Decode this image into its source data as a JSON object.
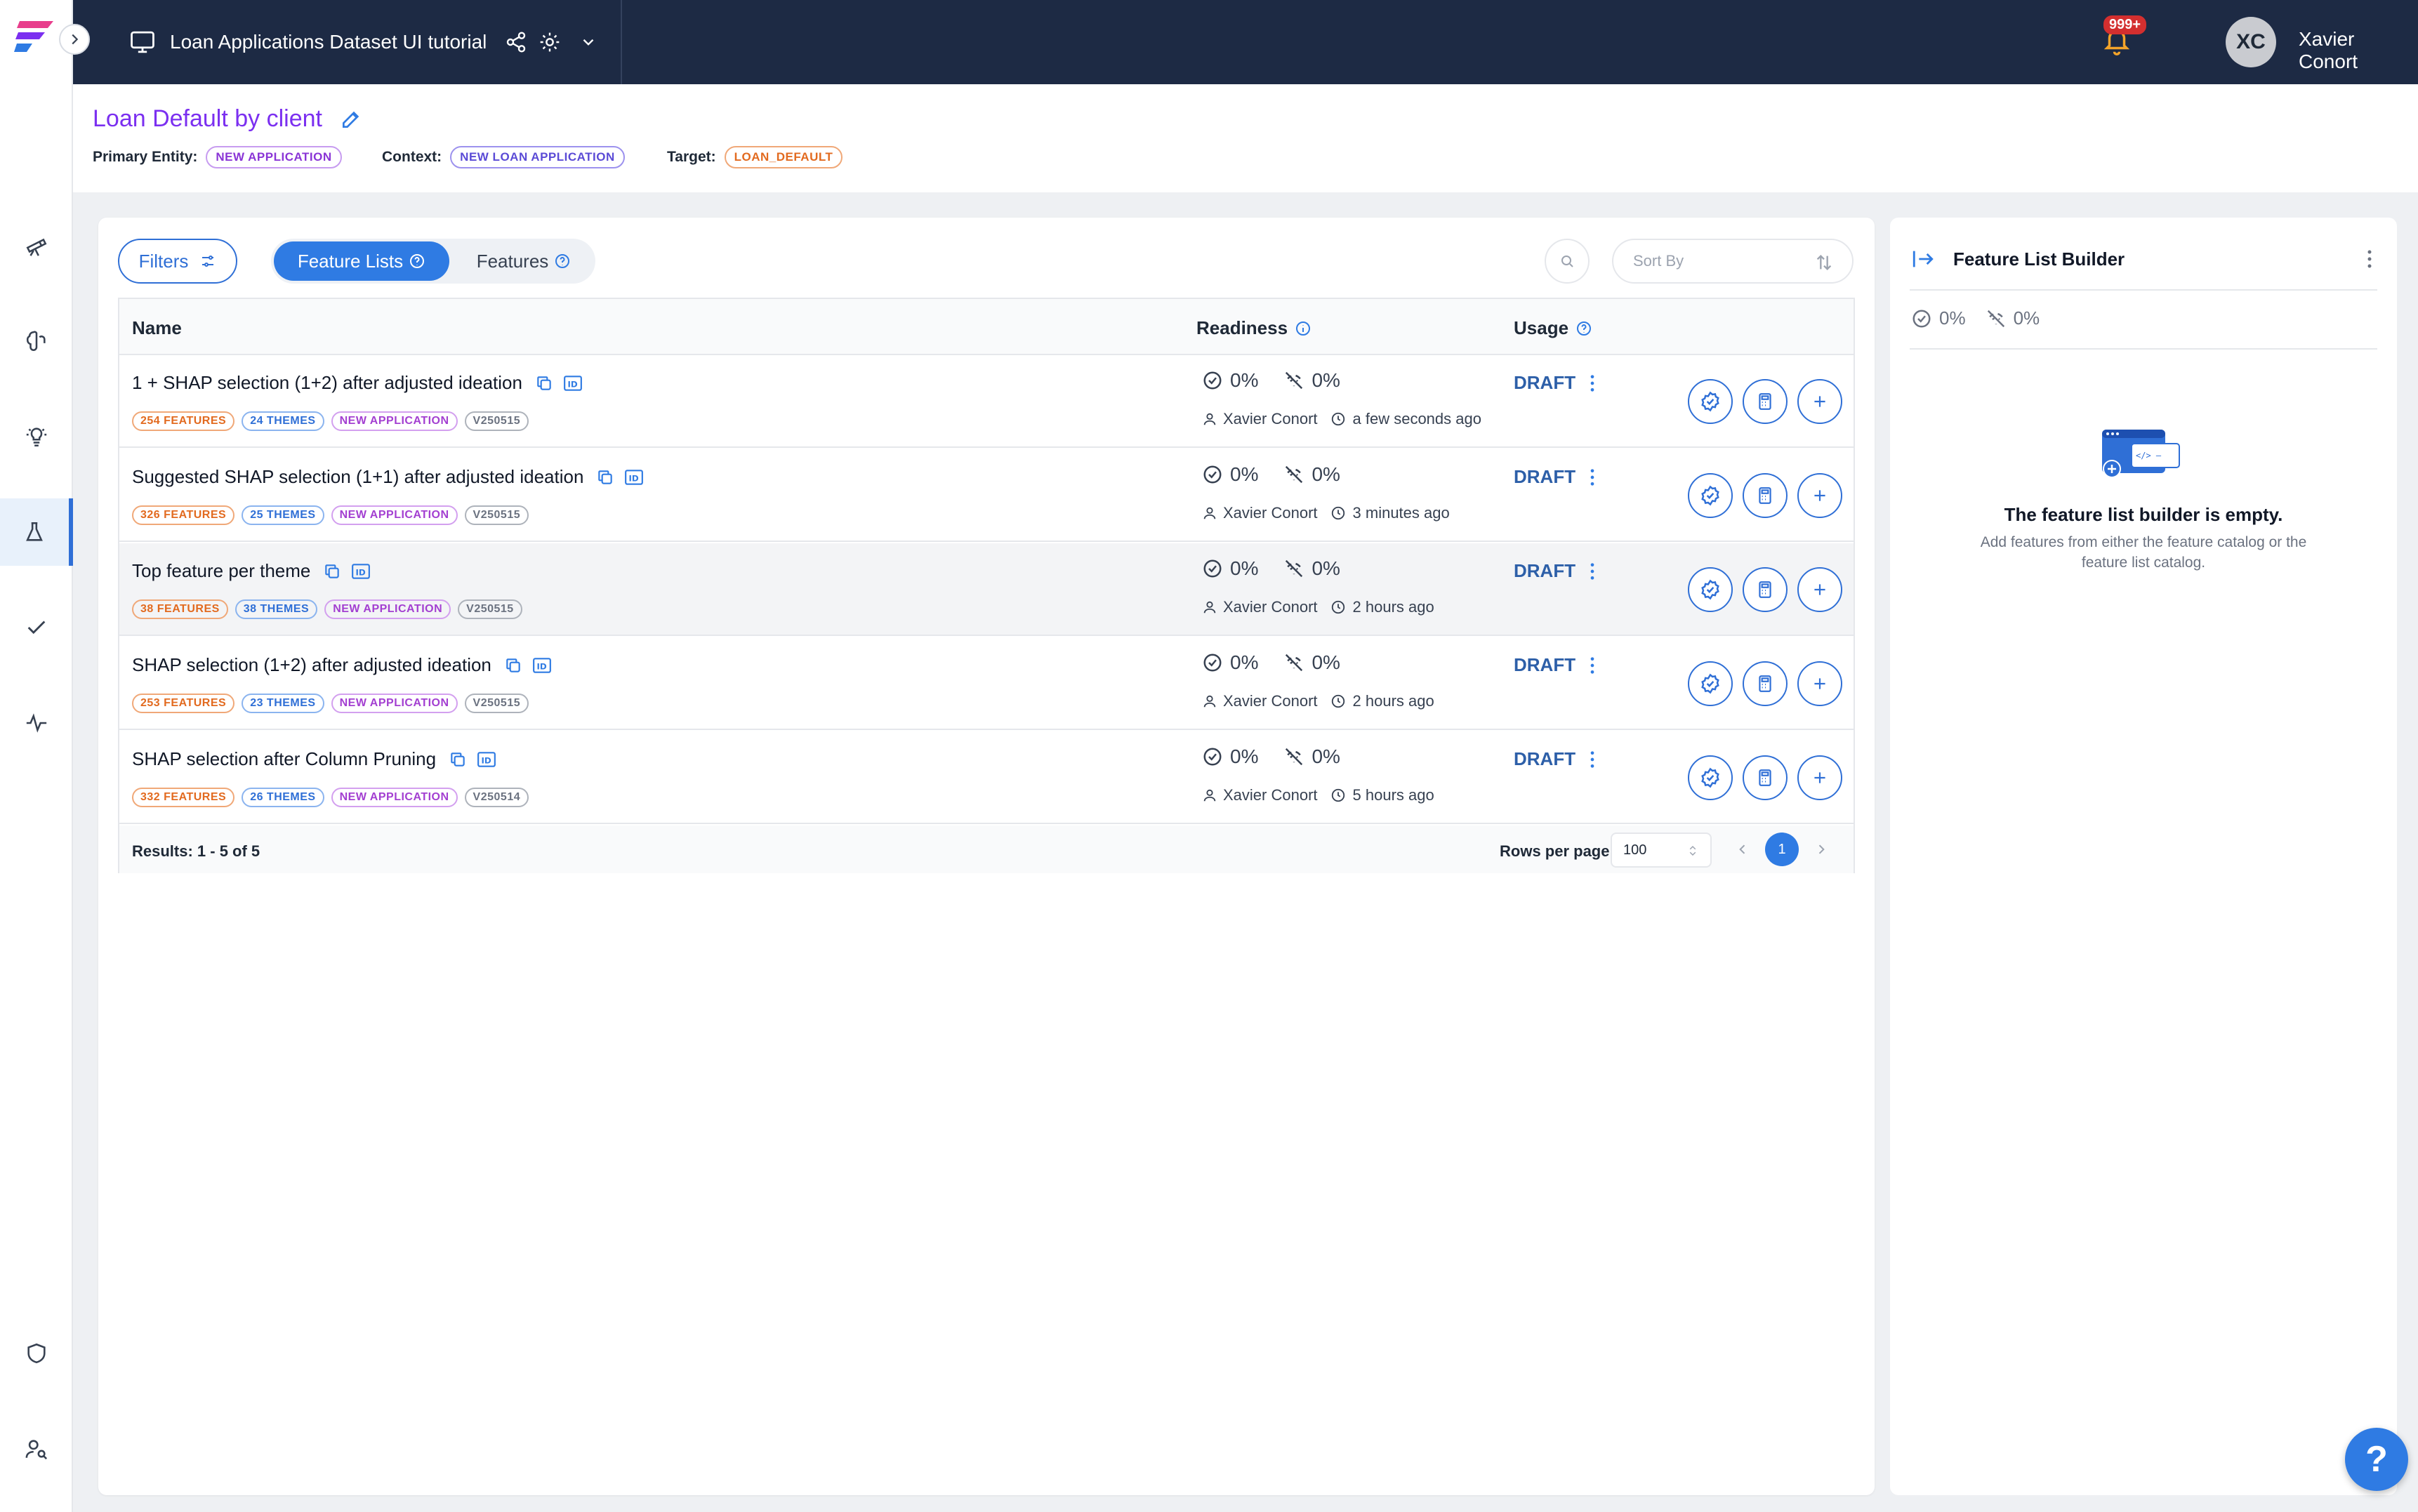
{
  "topbar": {
    "project_title": "Loan Applications Dataset UI tutorial",
    "notification_count": "999+",
    "avatar_initials": "XC",
    "user_name": "Xavier Conort"
  },
  "header": {
    "title": "Loan Default by client",
    "primary_entity_label": "Primary Entity:",
    "primary_entity_value": "NEW APPLICATION",
    "context_label": "Context:",
    "context_value": "NEW LOAN APPLICATION",
    "target_label": "Target:",
    "target_value": "LOAN_DEFAULT"
  },
  "toolbar": {
    "filters_label": "Filters",
    "tab_feature_lists": "Feature Lists",
    "tab_features": "Features",
    "sort_placeholder": "Sort By"
  },
  "table": {
    "columns": {
      "name": "Name",
      "readiness": "Readiness",
      "usage": "Usage"
    },
    "rows": [
      {
        "name": "1 + SHAP selection (1+2) after adjusted ideation",
        "features": "254 FEATURES",
        "themes": "24 THEMES",
        "entity": "NEW APPLICATION",
        "version": "V250515",
        "ready_pct": "0%",
        "online_pct": "0%",
        "owner": "Xavier Conort",
        "time": "a few seconds ago",
        "status": "DRAFT"
      },
      {
        "name": "Suggested SHAP selection (1+1) after adjusted ideation",
        "features": "326 FEATURES",
        "themes": "25 THEMES",
        "entity": "NEW APPLICATION",
        "version": "V250515",
        "ready_pct": "0%",
        "online_pct": "0%",
        "owner": "Xavier Conort",
        "time": "3 minutes ago",
        "status": "DRAFT"
      },
      {
        "name": "Top feature per theme",
        "features": "38 FEATURES",
        "themes": "38 THEMES",
        "entity": "NEW APPLICATION",
        "version": "V250515",
        "ready_pct": "0%",
        "online_pct": "0%",
        "owner": "Xavier Conort",
        "time": "2 hours ago",
        "status": "DRAFT"
      },
      {
        "name": "SHAP selection (1+2) after adjusted ideation",
        "features": "253 FEATURES",
        "themes": "23 THEMES",
        "entity": "NEW APPLICATION",
        "version": "V250515",
        "ready_pct": "0%",
        "online_pct": "0%",
        "owner": "Xavier Conort",
        "time": "2 hours ago",
        "status": "DRAFT"
      },
      {
        "name": "SHAP selection after Column Pruning",
        "features": "332 FEATURES",
        "themes": "26 THEMES",
        "entity": "NEW APPLICATION",
        "version": "V250514",
        "ready_pct": "0%",
        "online_pct": "0%",
        "owner": "Xavier Conort",
        "time": "5 hours ago",
        "status": "DRAFT"
      }
    ],
    "results_text": "Results: 1 - 5 of 5",
    "rows_per_page_label": "Rows per page:",
    "rows_per_page_value": "100",
    "current_page": "1"
  },
  "builder": {
    "title": "Feature List Builder",
    "ready_pct": "0%",
    "online_pct": "0%",
    "empty_title": "The feature list builder is empty.",
    "empty_sub": "Add features from either the feature catalog or the feature list catalog."
  },
  "help_label": "?",
  "colors": {
    "accent": "#2f7be3",
    "topbar": "#1d2a44",
    "title": "#7b2ff0",
    "draft": "#2d5fa8"
  }
}
